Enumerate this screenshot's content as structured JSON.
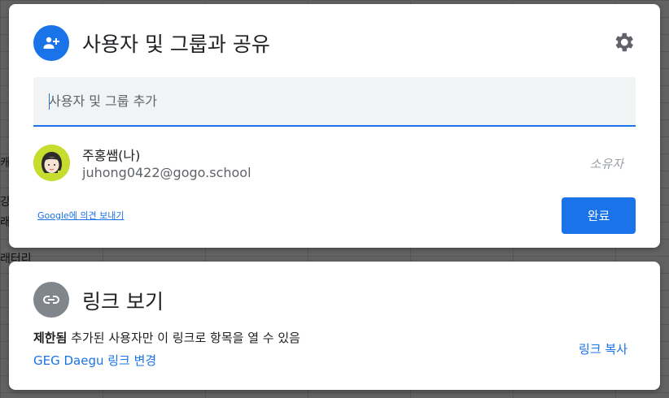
{
  "background": {
    "fragments": [
      "캐",
      "강",
      "래",
      "래터리"
    ]
  },
  "share_dialog": {
    "title": "사용자 및 그룹과 공유",
    "add_input": {
      "placeholder": "사용자 및 그룹 추가",
      "value": ""
    },
    "user": {
      "name": "주홍쌤(나)",
      "email": "juhong0422@gogo.school",
      "role": "소유자",
      "avatar_label": "주홍쌤"
    },
    "feedback_link": "Google에 의견 보내기",
    "done_button": "완료"
  },
  "link_dialog": {
    "title": "링크 보기",
    "restriction_bold": "제한됨",
    "restriction_text": " 추가된 사용자만 이 링크로 항목을 열 수 있음",
    "change_link": "GEG Daegu 링크 변경",
    "copy_link": "링크 복사"
  },
  "colors": {
    "accent": "#1a73e8",
    "avatar_bg": "#c6dc2e",
    "link_icon_bg": "#80868b"
  }
}
